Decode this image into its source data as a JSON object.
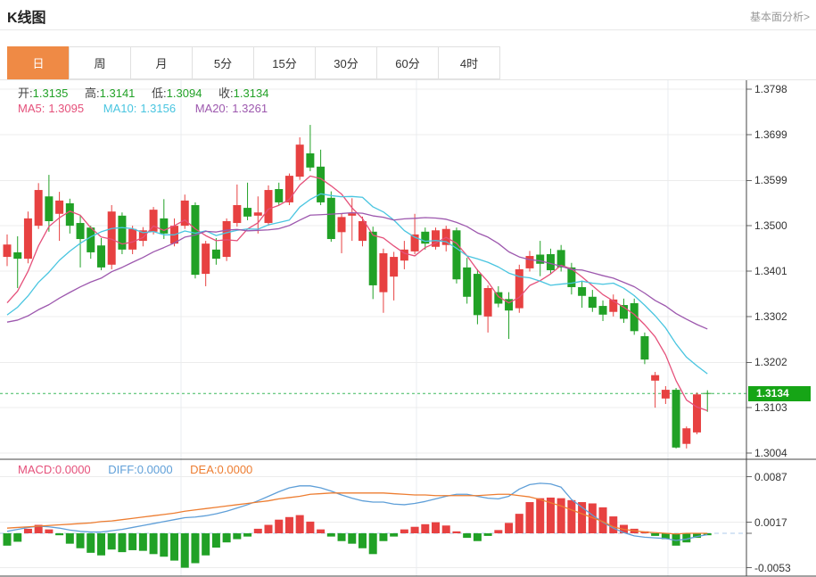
{
  "header": {
    "title": "K线图",
    "link": "基本面分析>"
  },
  "tabs": [
    {
      "label": "日",
      "active": true
    },
    {
      "label": "周",
      "active": false
    },
    {
      "label": "月",
      "active": false
    },
    {
      "label": "5分",
      "active": false
    },
    {
      "label": "15分",
      "active": false
    },
    {
      "label": "30分",
      "active": false
    },
    {
      "label": "60分",
      "active": false
    },
    {
      "label": "4时",
      "active": false
    }
  ],
  "legend": {
    "ohlc": [
      {
        "label": "开:",
        "value": "1.3135"
      },
      {
        "label": "高:",
        "value": "1.3141"
      },
      {
        "label": "低:",
        "value": "1.3094"
      },
      {
        "label": "收:",
        "value": "1.3134"
      }
    ],
    "ma": [
      {
        "label": "MA5:",
        "value": "1.3095"
      },
      {
        "label": "MA10:",
        "value": "1.3156"
      },
      {
        "label": "MA20:",
        "value": "1.3261"
      }
    ],
    "macd": [
      {
        "label": "MACD:",
        "value": "0.0000"
      },
      {
        "label": "DIFF:",
        "value": "0.0000"
      },
      {
        "label": "DEA:",
        "value": "0.0000"
      }
    ]
  },
  "axis": {
    "price_labels": [
      "1.3798",
      "1.3699",
      "1.3599",
      "1.3500",
      "1.3401",
      "1.3302",
      "1.3202",
      "1.3103",
      "1.3004"
    ],
    "macd_labels": [
      "0.0087",
      "0.0017",
      "-0.0053"
    ],
    "current_price_label": "1.3134"
  },
  "colors": {
    "up": "#e74141",
    "down": "#21a126",
    "ma5": "#e5507a",
    "ma10": "#49c5e0",
    "ma20": "#9d58ae",
    "diff": "#5f9fd8",
    "dea": "#ed7d31",
    "grid": "#ececec",
    "vgrid": "#e9edf0",
    "frame": "#444444",
    "dotted_price_line": "#3cb95c",
    "badge": "#16a516",
    "zero_dashed": "#aecbeb",
    "active_tab": "#ef8a45"
  },
  "chart_data": {
    "type": "candlestick",
    "title": "K线图 日线 (daily candlestick with MA5/MA10/MA20 and MACD)",
    "price_axis": {
      "top": 1.3798,
      "bottom": 1.3004
    },
    "current_price": 1.3134,
    "ma_windows": [
      5,
      10,
      20
    ],
    "prior_closes": [
      1.333,
      1.334,
      1.333,
      1.331,
      1.329,
      1.327,
      1.325,
      1.323,
      1.323,
      1.324,
      1.325,
      1.326,
      1.327,
      1.328,
      1.329,
      1.3295,
      1.33,
      1.33,
      1.33,
      1.33
    ],
    "candles": [
      [
        1.3432,
        1.3481,
        1.3412,
        1.3459
      ],
      [
        1.3442,
        1.3477,
        1.3364,
        1.3428
      ],
      [
        1.3428,
        1.3531,
        1.3418,
        1.3516
      ],
      [
        1.35,
        1.3593,
        1.3493,
        1.3578
      ],
      [
        1.3564,
        1.3611,
        1.3487,
        1.351
      ],
      [
        1.3526,
        1.3574,
        1.3467,
        1.3555
      ],
      [
        1.3549,
        1.3559,
        1.3483,
        1.35
      ],
      [
        1.3506,
        1.3522,
        1.3409,
        1.3471
      ],
      [
        1.3496,
        1.35,
        1.3428,
        1.3442
      ],
      [
        1.3457,
        1.3473,
        1.3403,
        1.3409
      ],
      [
        1.3415,
        1.3545,
        1.3405,
        1.3531
      ],
      [
        1.3522,
        1.3529,
        1.3438,
        1.3448
      ],
      [
        1.3448,
        1.35,
        1.3438,
        1.3493
      ],
      [
        1.3467,
        1.3497,
        1.3455,
        1.349
      ],
      [
        1.3487,
        1.3541,
        1.3481,
        1.3535
      ],
      [
        1.3516,
        1.3558,
        1.3471,
        1.3483
      ],
      [
        1.3461,
        1.3516,
        1.3455,
        1.35
      ],
      [
        1.35,
        1.3568,
        1.3493,
        1.3555
      ],
      [
        1.3545,
        1.3551,
        1.3385,
        1.3393
      ],
      [
        1.3395,
        1.3467,
        1.3368,
        1.3461
      ],
      [
        1.3448,
        1.3473,
        1.3415,
        1.3428
      ],
      [
        1.3432,
        1.3516,
        1.3423,
        1.351
      ],
      [
        1.3506,
        1.359,
        1.3498,
        1.3545
      ],
      [
        1.3539,
        1.3594,
        1.3512,
        1.352
      ],
      [
        1.3522,
        1.3564,
        1.3483,
        1.3529
      ],
      [
        1.3506,
        1.3588,
        1.35,
        1.3578
      ],
      [
        1.358,
        1.3594,
        1.3545,
        1.3551
      ],
      [
        1.3551,
        1.3614,
        1.3545,
        1.3609
      ],
      [
        1.3607,
        1.3693,
        1.36,
        1.3677
      ],
      [
        1.3658,
        1.372,
        1.3619,
        1.3627
      ],
      [
        1.3629,
        1.3666,
        1.3545,
        1.3551
      ],
      [
        1.3561,
        1.3575,
        1.3465,
        1.3471
      ],
      [
        1.3486,
        1.3527,
        1.344,
        1.3519
      ],
      [
        1.3522,
        1.356,
        1.3467,
        1.3527
      ],
      [
        1.3467,
        1.352,
        1.3455,
        1.351
      ],
      [
        1.3487,
        1.3498,
        1.334,
        1.337
      ],
      [
        1.3355,
        1.345,
        1.331,
        1.344
      ],
      [
        1.3389,
        1.3443,
        1.3337,
        1.3432
      ],
      [
        1.3424,
        1.3467,
        1.3405,
        1.3448
      ],
      [
        1.3444,
        1.3526,
        1.3438,
        1.3481
      ],
      [
        1.3487,
        1.3496,
        1.3448,
        1.3461
      ],
      [
        1.3454,
        1.3496,
        1.3448,
        1.349
      ],
      [
        1.3458,
        1.35,
        1.3444,
        1.3493
      ],
      [
        1.349,
        1.3496,
        1.3374,
        1.3383
      ],
      [
        1.3409,
        1.343,
        1.333,
        1.3345
      ],
      [
        1.3395,
        1.3405,
        1.3285,
        1.3305
      ],
      [
        1.3302,
        1.337,
        1.3267,
        1.3364
      ],
      [
        1.3355,
        1.3368,
        1.3322,
        1.333
      ],
      [
        1.334,
        1.3355,
        1.3253,
        1.3315
      ],
      [
        1.332,
        1.3415,
        1.331,
        1.3405
      ],
      [
        1.3407,
        1.3445,
        1.34,
        1.3434
      ],
      [
        1.3437,
        1.3467,
        1.339,
        1.3417
      ],
      [
        1.3438,
        1.345,
        1.3395,
        1.3403
      ],
      [
        1.3447,
        1.3458,
        1.34,
        1.3409
      ],
      [
        1.3409,
        1.3419,
        1.335,
        1.3366
      ],
      [
        1.3366,
        1.338,
        1.3321,
        1.3347
      ],
      [
        1.3345,
        1.336,
        1.3312,
        1.3321
      ],
      [
        1.3325,
        1.3337,
        1.3292,
        1.3306
      ],
      [
        1.3312,
        1.335,
        1.3302,
        1.3339
      ],
      [
        1.3327,
        1.3341,
        1.3288,
        1.3297
      ],
      [
        1.3331,
        1.3341,
        1.3262,
        1.327
      ],
      [
        1.3259,
        1.3267,
        1.3198,
        1.3208
      ],
      [
        1.3162,
        1.3181,
        1.3103,
        1.3174
      ],
      [
        1.3123,
        1.315,
        1.3111,
        1.3142
      ],
      [
        1.3142,
        1.3146,
        1.3014,
        1.3016
      ],
      [
        1.3024,
        1.3062,
        1.3014,
        1.3058
      ],
      [
        1.3049,
        1.3136,
        1.3045,
        1.3132
      ],
      [
        1.3135,
        1.3141,
        1.3094,
        1.3134
      ]
    ],
    "macd": {
      "unit": 0.0001,
      "axis_values": [
        0.0087,
        0.0017,
        -0.0053
      ],
      "zero": 0,
      "hist": [
        -19,
        -13,
        7,
        13,
        6,
        -3,
        -16,
        -23,
        -30,
        -34,
        -25,
        -29,
        -26,
        -27,
        -32,
        -36,
        -42,
        -53,
        -46,
        -34,
        -22,
        -14,
        -9,
        -5,
        7,
        13,
        21,
        25,
        28,
        18,
        6,
        -5,
        -12,
        -16,
        -23,
        -32,
        -12,
        -5,
        6,
        10,
        14,
        17,
        12,
        3,
        -7,
        -12,
        -4,
        5,
        16,
        30,
        48,
        54,
        55,
        54,
        51,
        48,
        46,
        40,
        26,
        13,
        7,
        3,
        -4,
        -9,
        -19,
        -14,
        -7,
        -3
      ],
      "diff": [
        3,
        6,
        9,
        11,
        10,
        8,
        5,
        3,
        2,
        2,
        4,
        6,
        9,
        12,
        15,
        18,
        21,
        24,
        25,
        27,
        30,
        34,
        39,
        44,
        50,
        57,
        64,
        70,
        73,
        73,
        70,
        65,
        59,
        54,
        50,
        48,
        48,
        45,
        44,
        46,
        49,
        53,
        57,
        60,
        60,
        57,
        54,
        53,
        57,
        68,
        75,
        77,
        76,
        71,
        52,
        40,
        28,
        17,
        8,
        1,
        -4,
        -6,
        -7,
        -8,
        -11,
        -9,
        -5,
        -2
      ],
      "dea": [
        8,
        9,
        10,
        11,
        12,
        13,
        14,
        15,
        16,
        18,
        19,
        21,
        23,
        25,
        27,
        29,
        31,
        34,
        36,
        38,
        40,
        42,
        44,
        46,
        48,
        50,
        53,
        55,
        57,
        60,
        61,
        62,
        62,
        62,
        62,
        62,
        62,
        61,
        60,
        59,
        59,
        58,
        58,
        58,
        58,
        58,
        59,
        60,
        60,
        58,
        56,
        52,
        47,
        42,
        36,
        30,
        24,
        18,
        10,
        6,
        4,
        2,
        1,
        0,
        -1,
        0,
        0,
        0
      ]
    }
  }
}
